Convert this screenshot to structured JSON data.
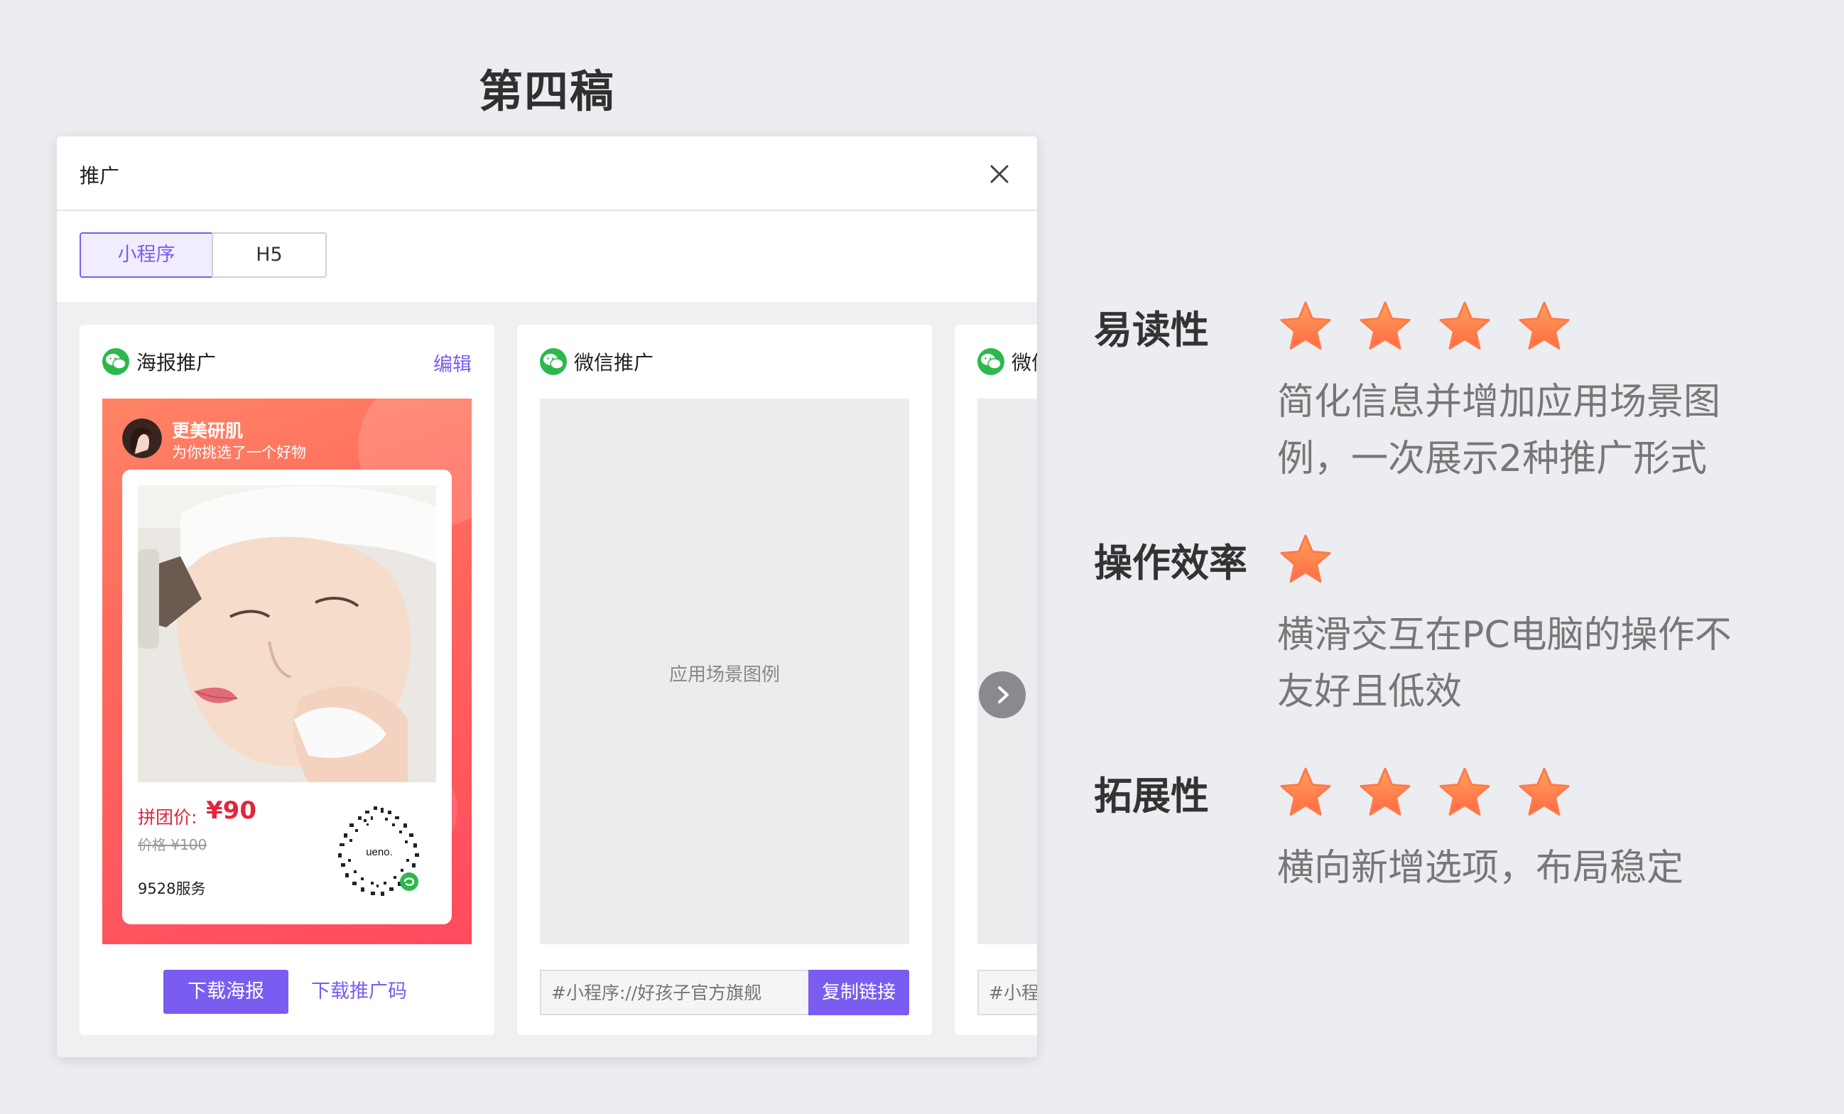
{
  "page_title": "第四稿",
  "dialog": {
    "title": "推广",
    "tabs": [
      {
        "label": "小程序",
        "active": true
      },
      {
        "label": "H5",
        "active": false
      }
    ],
    "cards": [
      {
        "title": "海报推广",
        "edit_label": "编辑",
        "poster": {
          "brand_name": "更美研肌",
          "brand_sub": "为你挑选了一个好物",
          "price_label": "拼团价:",
          "price_value": "¥90",
          "original_price": "价格 ¥100",
          "service": "9528服务",
          "qr_text": "ueno."
        },
        "primary_button": "下载海报",
        "link_button": "下载推广码"
      },
      {
        "title": "微信推广",
        "placeholder": "应用场景图例",
        "link_placeholder": "#小程序://好孩子官方旗舰",
        "copy_button": "复制链接"
      },
      {
        "title": "微信推广",
        "link_placeholder": "#小程序://好孩子官方旗舰"
      }
    ]
  },
  "evaluation": [
    {
      "label": "易读性",
      "stars": 4,
      "desc_lines": [
        "简化信息并增加应用场景图",
        "例，一次展示2种推广形式"
      ]
    },
    {
      "label": "操作效率",
      "stars": 1,
      "desc_lines": [
        "横滑交互在PC电脑的操作不",
        "友好且低效"
      ]
    },
    {
      "label": "拓展性",
      "stars": 4,
      "desc_lines": [
        "横向新增选项，布局稳定"
      ]
    }
  ],
  "colors": {
    "accent": "#7b5cf0",
    "wechat_green": "#2db84d",
    "price_red": "#e6233e",
    "star_orange": "#ff8a4a"
  }
}
